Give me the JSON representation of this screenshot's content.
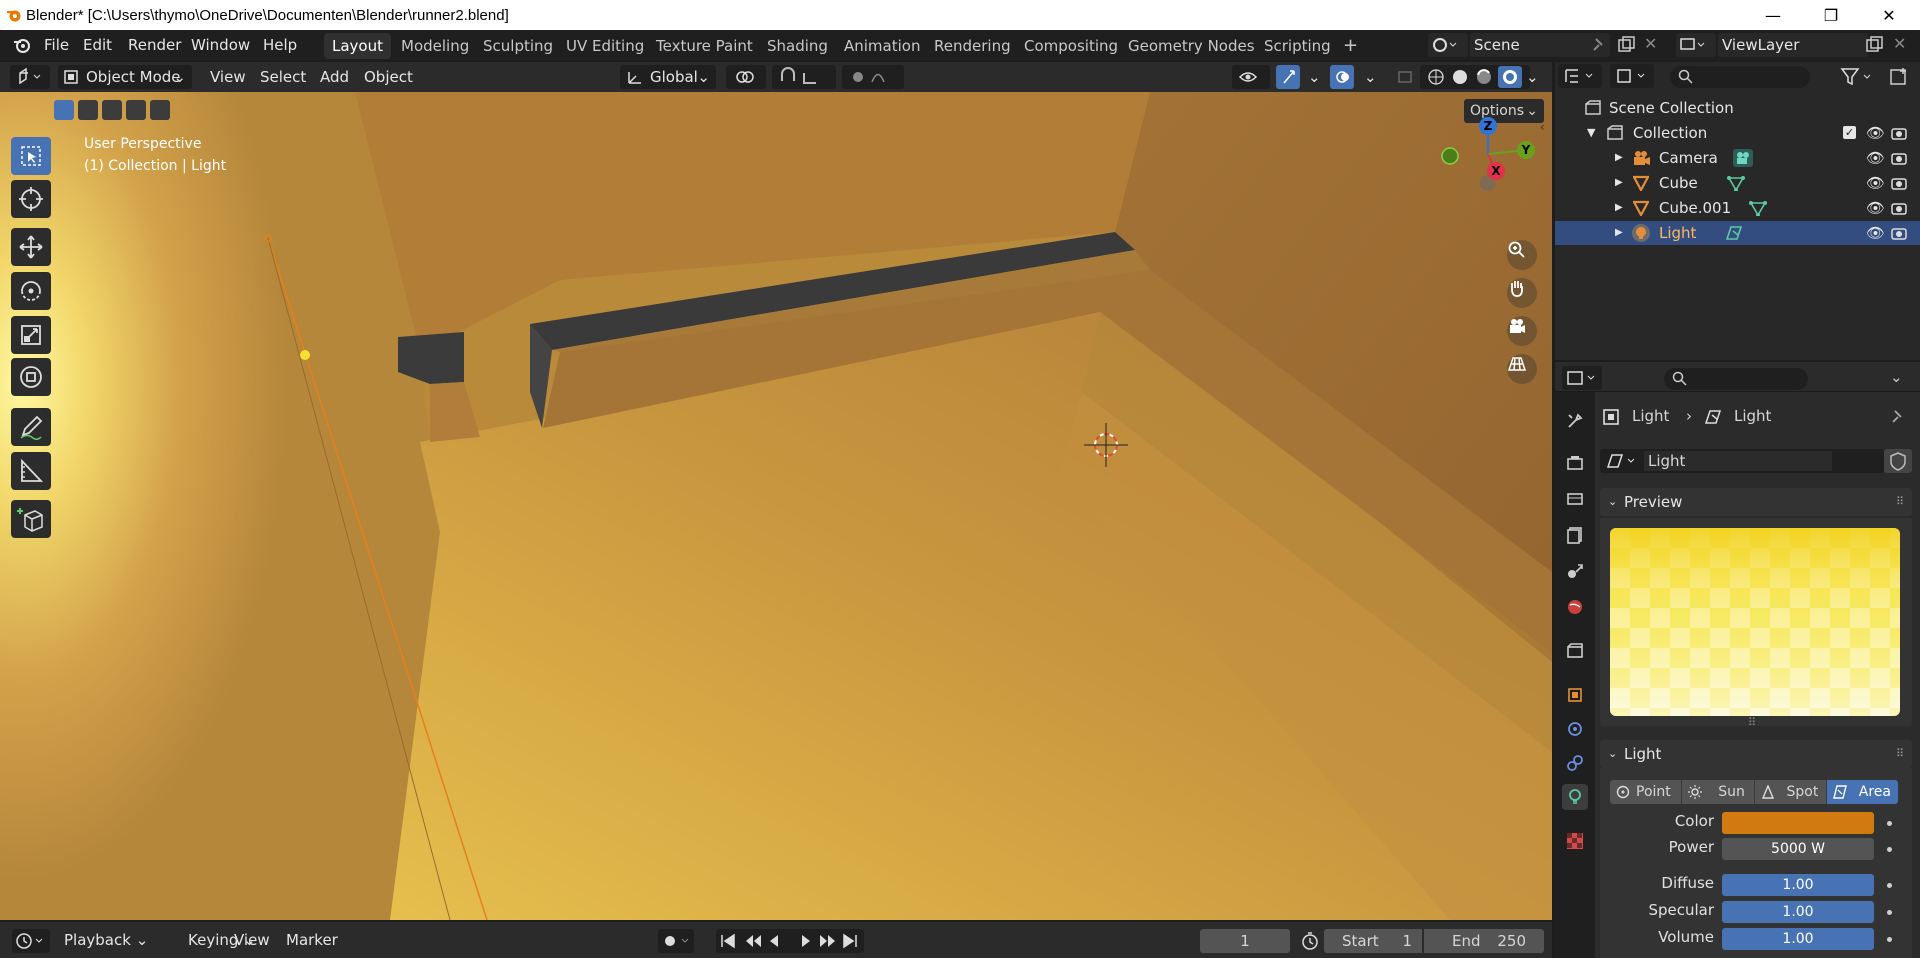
{
  "window": {
    "title": "Blender* [C:\\Users\\thymo\\OneDrive\\Documenten\\Blender\\runner2.blend]",
    "controls": [
      "—",
      "❐",
      "✕"
    ]
  },
  "menu": [
    "File",
    "Edit",
    "Render",
    "Window",
    "Help"
  ],
  "workspaces": {
    "tabs": [
      "Layout",
      "Modeling",
      "Sculpting",
      "UV Editing",
      "Texture Paint",
      "Shading",
      "Animation",
      "Rendering",
      "Compositing",
      "Geometry Nodes",
      "Scripting"
    ],
    "active": "Layout",
    "add": "+"
  },
  "scene": {
    "name": "Scene",
    "view_layer": "ViewLayer"
  },
  "viewport_header": {
    "mode": "Object Mode",
    "menus": [
      "View",
      "Select",
      "Add",
      "Object"
    ],
    "transform_orientation": "Global",
    "options": "Options"
  },
  "viewport": {
    "perspective": "User Perspective",
    "collection_info": "(1) Collection | Light",
    "gizmo": {
      "z": "Z",
      "y": "Y",
      "x": "X"
    }
  },
  "outliner": {
    "root": "Scene Collection",
    "collection": "Collection",
    "items": [
      {
        "name": "Camera",
        "icon": "camera-icon"
      },
      {
        "name": "Cube",
        "icon": "mesh-icon"
      },
      {
        "name": "Cube.001",
        "icon": "mesh-icon"
      },
      {
        "name": "Light",
        "icon": "light-icon",
        "selected": true
      }
    ]
  },
  "properties": {
    "breadcrumb": {
      "object": "Light",
      "data": "Light"
    },
    "datablock": "Light",
    "preview_label": "Preview",
    "light_label": "Light",
    "light_types": [
      "Point",
      "Sun",
      "Spot",
      "Area"
    ],
    "active_type": "Area",
    "rows": [
      {
        "label": "Color",
        "value": "",
        "color": "#d07a0f"
      },
      {
        "label": "Power",
        "value": "5000 W",
        "color": "#545454"
      },
      {
        "label": "Diffuse",
        "value": "1.00",
        "color": "#4772b3"
      },
      {
        "label": "Specular",
        "value": "1.00",
        "color": "#4772b3"
      },
      {
        "label": "Volume",
        "value": "1.00",
        "color": "#4772b3"
      }
    ]
  },
  "timeline": {
    "menus": [
      "Playback",
      "Keying",
      "View",
      "Marker"
    ],
    "current_frame": "1",
    "start_label": "Start",
    "start": "1",
    "end_label": "End",
    "end": "250"
  }
}
